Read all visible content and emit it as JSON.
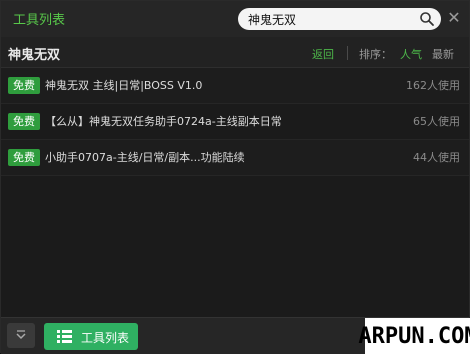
{
  "app": {
    "title": "工具列表"
  },
  "search": {
    "value": "神鬼无双"
  },
  "section": {
    "title": "神鬼无双",
    "back_label": "返回",
    "sort_label": "排序：",
    "sort_popular": "人气",
    "sort_latest": "最新"
  },
  "items": [
    {
      "badge": "免费",
      "name": "神鬼无双 主线|日常|BOSS V1.0",
      "usage": "162人使用"
    },
    {
      "badge": "免费",
      "name": "【么从】神鬼无双任务助手0724a-主线副本日常",
      "usage": "65人使用"
    },
    {
      "badge": "免费",
      "name": "小助手0707a-主线/日常/副本...功能陆续",
      "usage": "44人使用"
    }
  ],
  "footer": {
    "tool_list_label": "工具列表"
  },
  "watermark": {
    "text": "ARPUN.COM"
  },
  "colors": {
    "accent": "#58c84a",
    "badge": "#2f9d3d",
    "button": "#2fb062"
  },
  "icons": {
    "search": "search-icon",
    "close": "close-icon",
    "expand": "chevron-down-icon",
    "tool_list": "list-icon"
  }
}
